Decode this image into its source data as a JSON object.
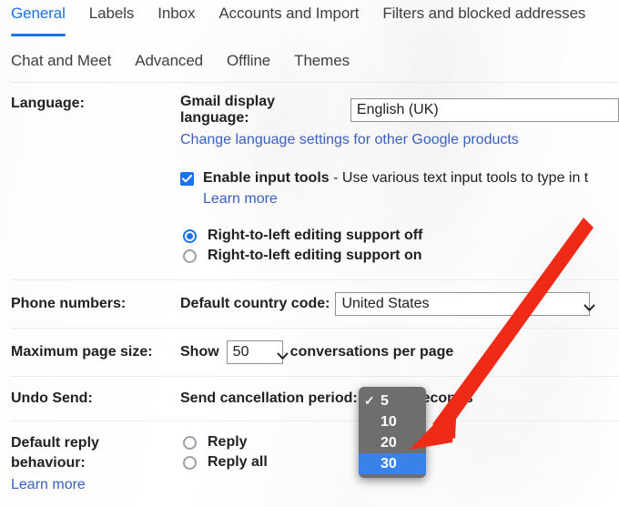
{
  "tabs": {
    "row1": [
      {
        "label": "General",
        "active": true
      },
      {
        "label": "Labels",
        "active": false
      },
      {
        "label": "Inbox",
        "active": false
      },
      {
        "label": "Accounts and Import",
        "active": false
      },
      {
        "label": "Filters and blocked addresses",
        "active": false
      }
    ],
    "row2": [
      {
        "label": "Chat and Meet",
        "active": false
      },
      {
        "label": "Advanced",
        "active": false
      },
      {
        "label": "Offline",
        "active": false
      },
      {
        "label": "Themes",
        "active": false
      }
    ]
  },
  "language": {
    "row_label": "Language:",
    "display_language_label": "Gmail display language:",
    "display_language_value": "English (UK)",
    "change_settings_link": "Change language settings for other Google products",
    "input_tools_label": "Enable input tools",
    "input_tools_description": " - Use various text input tools to type in t",
    "input_tools_checked": true,
    "learn_more": "Learn more",
    "rtl_off": "Right-to-left editing support off",
    "rtl_on": "Right-to-left editing support on",
    "rtl_selected": "off"
  },
  "phone_numbers": {
    "row_label": "Phone numbers:",
    "country_code_label": "Default country code:",
    "country_code_value": "United States"
  },
  "max_page_size": {
    "row_label": "Maximum page size:",
    "show_label": "Show",
    "value": "50",
    "suffix_label": "conversations per page"
  },
  "undo_send": {
    "row_label": "Undo Send:",
    "text_before": "Send cancellation period:",
    "text_after": "seconds"
  },
  "default_reply": {
    "row_label_line1": "Default reply",
    "row_label_line2": "behaviour:",
    "learn_more": "Learn more",
    "option_reply": "Reply",
    "option_reply_all": "Reply all",
    "selected": ""
  },
  "dropdown_popup": {
    "options": [
      {
        "label": "5",
        "checked": true,
        "highlighted": false
      },
      {
        "label": "10",
        "checked": false,
        "highlighted": false
      },
      {
        "label": "20",
        "checked": false,
        "highlighted": false
      },
      {
        "label": "30",
        "checked": false,
        "highlighted": true
      }
    ],
    "check_glyph": "✓",
    "background_color": "#6e6e6e",
    "highlight_color": "#3b82e8"
  },
  "annotation": {
    "arrow_color": "#ef2b18",
    "arrow_name": "red-pointer-arrow"
  },
  "colors": {
    "accent": "#1a73e8",
    "link": "#3b5fc0",
    "text": "#202124",
    "divider": "#ececec"
  }
}
